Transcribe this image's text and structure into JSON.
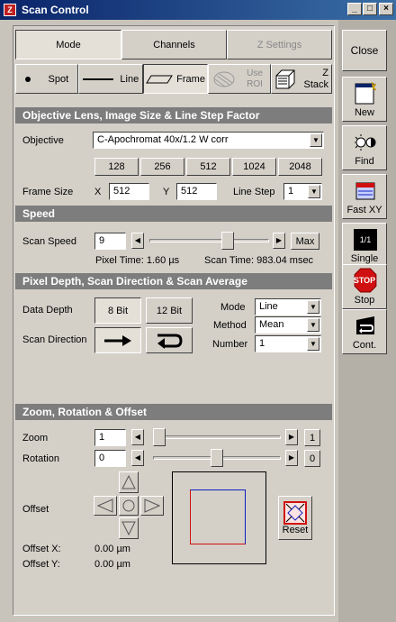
{
  "window": {
    "title": "Scan Control",
    "minimize": "_",
    "maximize": "□",
    "close": "×"
  },
  "mode_tabs": [
    {
      "label": "Mode",
      "active": true
    },
    {
      "label": "Channels",
      "active": false
    },
    {
      "label": "Z Settings",
      "active": false,
      "disabled": true
    }
  ],
  "scan_modes": {
    "spot": "Spot",
    "line": "Line",
    "frame": "Frame",
    "use_roi": "Use ROI",
    "z_stack": "Z Stack"
  },
  "objective_section": {
    "title": "Objective Lens, Image Size & Line Step Factor",
    "objective_label": "Objective",
    "objective_value": "C-Apochromat 40x/1.2 W corr",
    "size_presets": [
      "128",
      "256",
      "512",
      "1024",
      "2048"
    ],
    "frame_size_label": "Frame Size",
    "x_label": "X",
    "x_value": "512",
    "y_label": "Y",
    "y_value": "512",
    "line_step_label": "Line Step",
    "line_step_value": "1"
  },
  "speed_section": {
    "title": "Speed",
    "scan_speed_label": "Scan Speed",
    "scan_speed_value": "9",
    "scan_speed_level": 0.67,
    "max_label": "Max",
    "pixel_time": "Pixel Time:  1.60 µs",
    "scan_time": "Scan Time:  983.04 msec"
  },
  "pixel_section": {
    "title": "Pixel Depth, Scan Direction & Scan Average",
    "data_depth_label": "Data Depth",
    "bit8": "8 Bit",
    "bit12": "12 Bit",
    "scan_direction_label": "Scan Direction",
    "mode_label": "Mode",
    "mode_value": "Line",
    "method_label": "Method",
    "method_value": "Mean",
    "number_label": "Number",
    "number_value": "1"
  },
  "zoom_section": {
    "title": "Zoom, Rotation & Offset",
    "zoom_label": "Zoom",
    "zoom_value": "1",
    "zoom_reset": "1",
    "zoom_level": 0.0,
    "rotation_label": "Rotation",
    "rotation_value": "0",
    "rotation_reset": "0",
    "rotation_level": 0.5,
    "offset_label": "Offset",
    "reset_label": "Reset",
    "offset_x_label": "Offset X:",
    "offset_x_value": "0.00 µm",
    "offset_y_label": "Offset Y:",
    "offset_y_value": "0.00 µm"
  },
  "side_buttons": {
    "close": "Close",
    "new": "New",
    "find": "Find",
    "fast_xy": "Fast XY",
    "single": "Single",
    "stop": "Stop",
    "stop_sign": "STOP",
    "single_icon": "1/1",
    "cont": "Cont."
  },
  "colors": {
    "section_header": "#7d7d7d",
    "title_bar": "#0a246a",
    "stop_red": "#d01010",
    "frame_blue": "#1020c0",
    "frame_red": "#d01010"
  }
}
